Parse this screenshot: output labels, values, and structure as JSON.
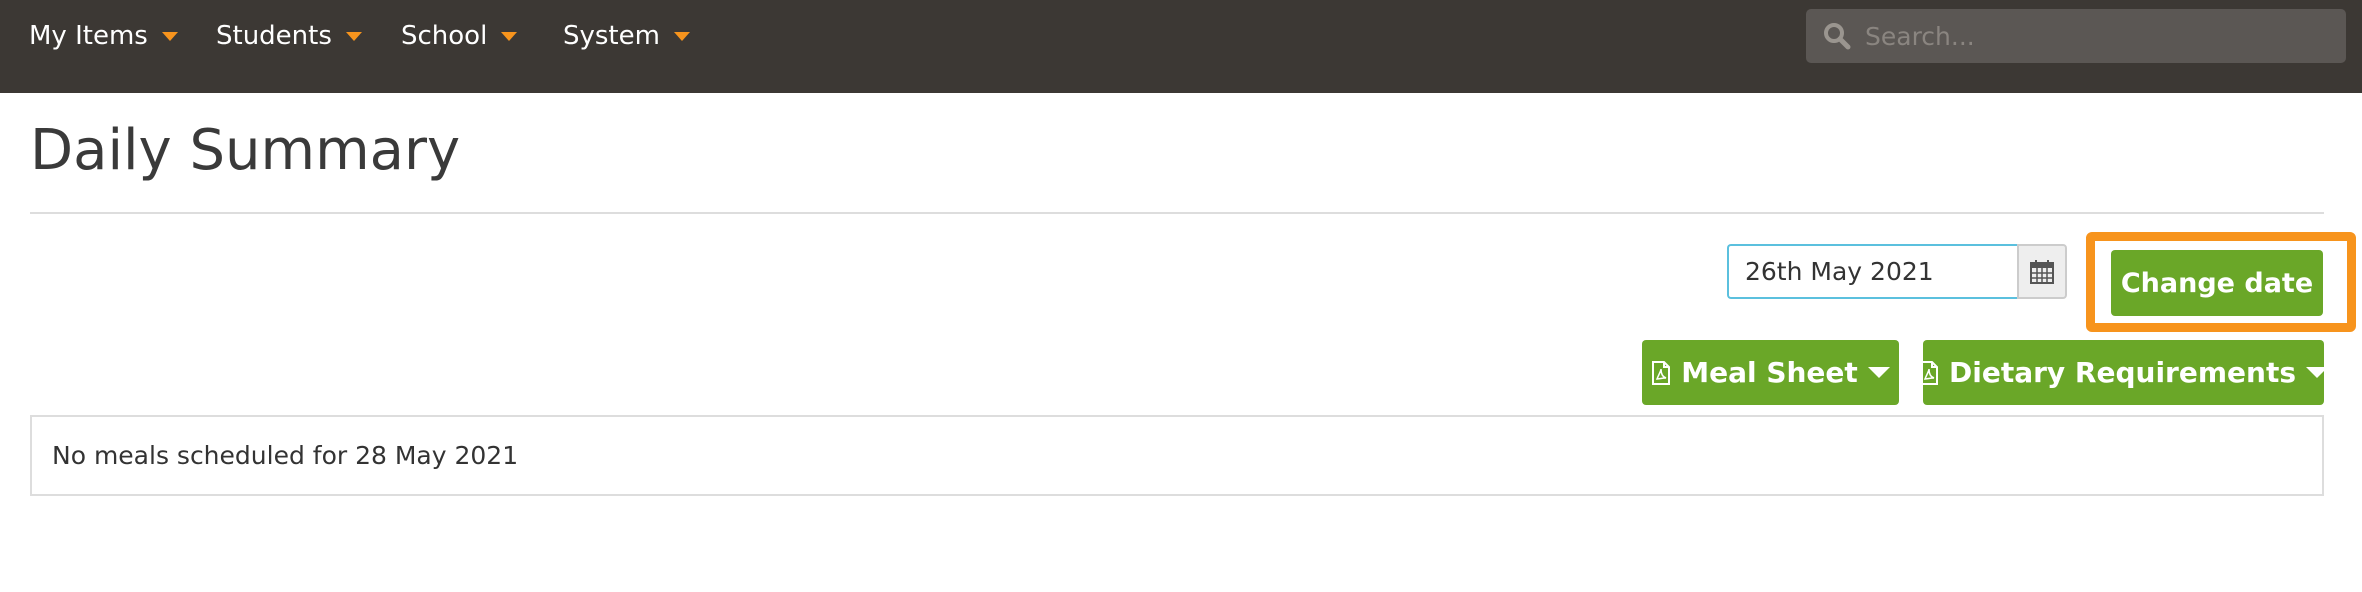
{
  "nav": {
    "items": [
      {
        "label": "My Items"
      },
      {
        "label": "Students"
      },
      {
        "label": "School"
      },
      {
        "label": "System"
      }
    ],
    "search": {
      "placeholder": "Search...",
      "value": ""
    }
  },
  "page": {
    "title": "Daily Summary"
  },
  "date_picker": {
    "value": "26th May 2021",
    "button_label": "Change date"
  },
  "actions": {
    "meal_sheet_label": "Meal Sheet",
    "dietary_label": "Dietary Requirements"
  },
  "message": {
    "text": "No meals scheduled for 28 May 2021"
  },
  "colors": {
    "navbar": "#3c3834",
    "accent_orange": "#f7941d",
    "button_green": "#6aa728",
    "input_focus": "#5bc0de"
  },
  "icons": {
    "search": "search-icon",
    "calendar": "calendar-icon",
    "pdf": "pdf-icon",
    "caret": "caret-down-icon"
  }
}
